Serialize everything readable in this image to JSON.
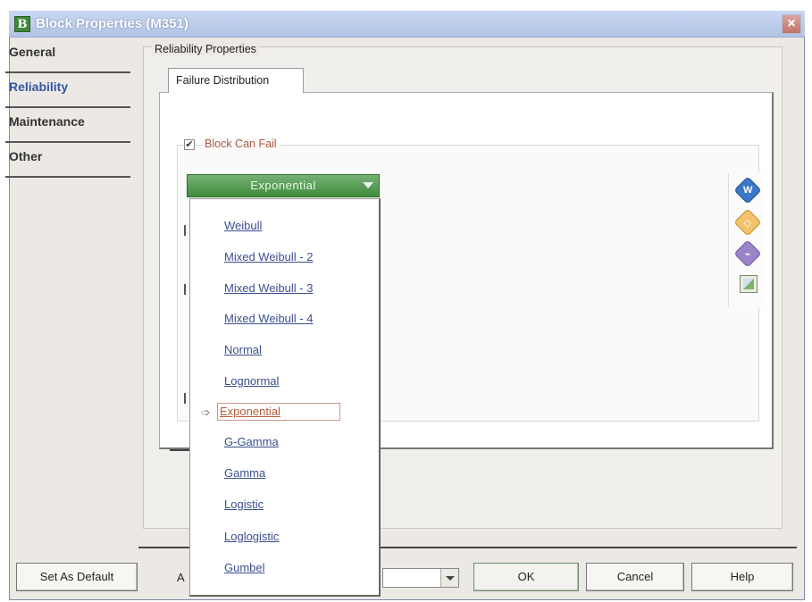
{
  "window": {
    "title": "Block Properties (M351)",
    "app_icon_letter": "B",
    "close_glyph": "×"
  },
  "nav": {
    "items": [
      {
        "label": "General",
        "active": false
      },
      {
        "label": "Reliability",
        "active": true
      },
      {
        "label": "Maintenance",
        "active": false
      },
      {
        "label": "Other",
        "active": false
      }
    ]
  },
  "reliability": {
    "group_title": "Reliability Properties",
    "tab_label": "Failure Distribution",
    "block_can_fail_label": "Block Can Fail",
    "block_can_fail_checked": true,
    "checkbox_glyph": "✔"
  },
  "distribution": {
    "selected": "Exponential",
    "options": [
      "Weibull",
      "Mixed Weibull - 2",
      "Mixed Weibull - 3",
      "Mixed Weibull - 4",
      "Normal",
      "Lognormal",
      "Exponential",
      "G-Gamma",
      "Gamma",
      "Logistic",
      "Loglogistic",
      "Gumbel"
    ],
    "pointer_glyph": "➩"
  },
  "side_tools": {
    "icons": [
      "weibull-icon",
      "diamond-icon",
      "plot-icon",
      "image-icon"
    ]
  },
  "footer": {
    "set_default_label": "Set As Default",
    "combo_prefix": "A",
    "ok_label": "OK",
    "cancel_label": "Cancel",
    "help_label": "Help"
  }
}
